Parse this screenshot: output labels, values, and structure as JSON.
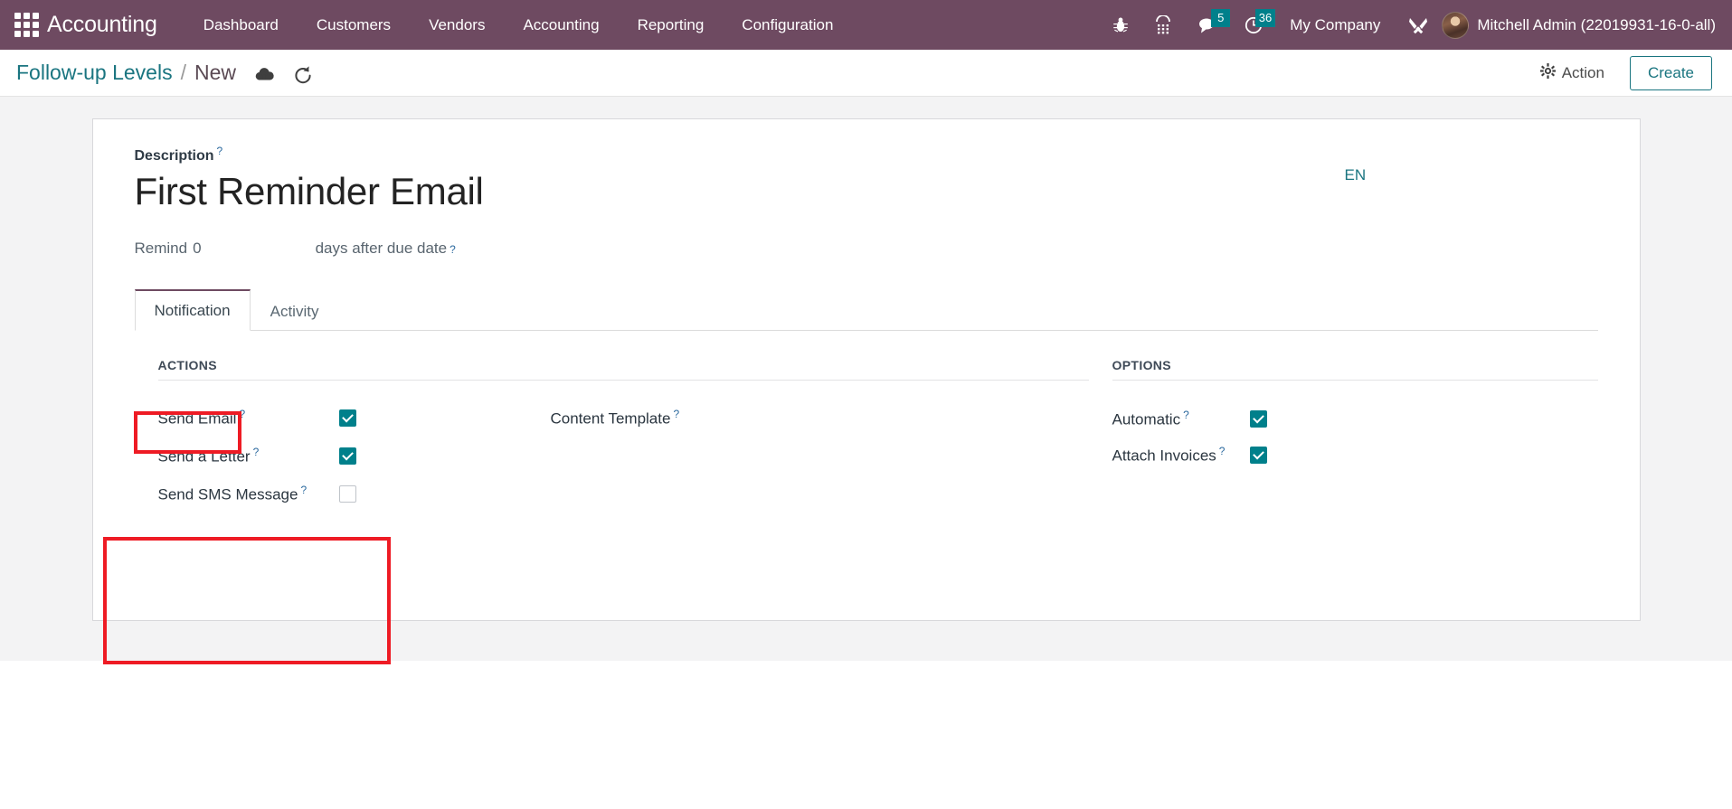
{
  "navbar": {
    "apps_icon": "apps-grid-icon",
    "brand": "Accounting",
    "menu": [
      {
        "label": "Dashboard"
      },
      {
        "label": "Customers"
      },
      {
        "label": "Vendors"
      },
      {
        "label": "Accounting"
      },
      {
        "label": "Reporting"
      },
      {
        "label": "Configuration"
      }
    ],
    "sys_icons": [
      {
        "name": "bug-icon",
        "glyph": "⚘"
      },
      {
        "name": "dialpad-icon",
        "glyph": "☎"
      }
    ],
    "messages_badge": "5",
    "activities_badge": "36",
    "company": "My Company",
    "tools_icon": "tools-icon",
    "user": "Mitchell Admin (22019931-16-0-all)"
  },
  "control_panel": {
    "breadcrumb_parent": "Follow-up Levels",
    "breadcrumb_separator": "/",
    "breadcrumb_current": "New",
    "save_icon": "cloud-upload-save-icon",
    "discard_icon": "discard-undo-icon",
    "action_label": "Action",
    "action_icon": "gear-icon",
    "create_label": "Create"
  },
  "form": {
    "description_label": "Description",
    "description_hint": "?",
    "title": "First Reminder Email",
    "language_badge": "EN",
    "remind_prefix": "Remind",
    "remind_days": "0",
    "remind_suffix": "days after due date",
    "remind_hint": "?"
  },
  "tabs": [
    {
      "label": "Notification",
      "active": true
    },
    {
      "label": "Activity",
      "active": false
    }
  ],
  "notification": {
    "actions_group_title": "ACTIONS",
    "options_group_title": "OPTIONS",
    "actions": [
      {
        "label": "Send Email",
        "checked": true
      },
      {
        "label": "Send a Letter",
        "checked": true
      },
      {
        "label": "Send SMS Message",
        "checked": false
      }
    ],
    "content_template_label": "Content Template",
    "content_template_value": "",
    "options": [
      {
        "label": "Automatic",
        "checked": true
      },
      {
        "label": "Attach Invoices",
        "checked": true
      }
    ]
  },
  "annotations": {
    "tab_highlight": "Notification",
    "actions_highlight": "Send Email / Send a Letter / Send SMS Message",
    "color": "#ee1b24"
  },
  "colors": {
    "navbar_purple": "#6e4a61",
    "accent_teal": "#00808b",
    "link_teal": "#1a7580",
    "page_bg": "#f3f3f4",
    "annotation_red": "#ee1b24"
  }
}
